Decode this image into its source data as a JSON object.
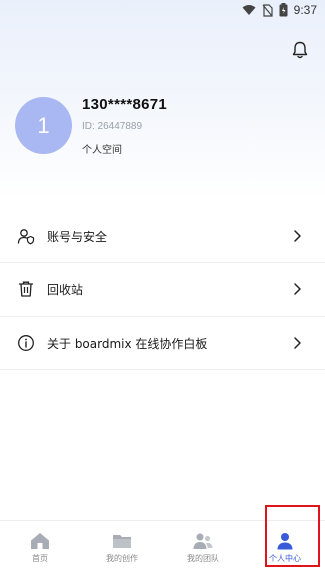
{
  "status_bar": {
    "time": "9:37"
  },
  "profile": {
    "avatar_initial": "1",
    "phone": "130****8671",
    "id_text": "ID: 26447889",
    "space_text": "个人空间"
  },
  "menu": {
    "items": [
      {
        "label": "账号与安全",
        "icon": "user-shield-icon"
      },
      {
        "label": "回收站",
        "icon": "trash-icon"
      },
      {
        "label": "关于 boardmix 在线协作白板",
        "icon": "info-icon"
      }
    ]
  },
  "bottom_nav": {
    "items": [
      {
        "label": "首页",
        "icon": "home-icon"
      },
      {
        "label": "我的创作",
        "icon": "folder-icon"
      },
      {
        "label": "我的团队",
        "icon": "team-icon"
      },
      {
        "label": "个人中心",
        "icon": "person-icon",
        "active": true
      }
    ]
  },
  "colors": {
    "accent": "#3a5bd9",
    "avatar": "#a9b8f2",
    "highlight": "#e0121a"
  }
}
